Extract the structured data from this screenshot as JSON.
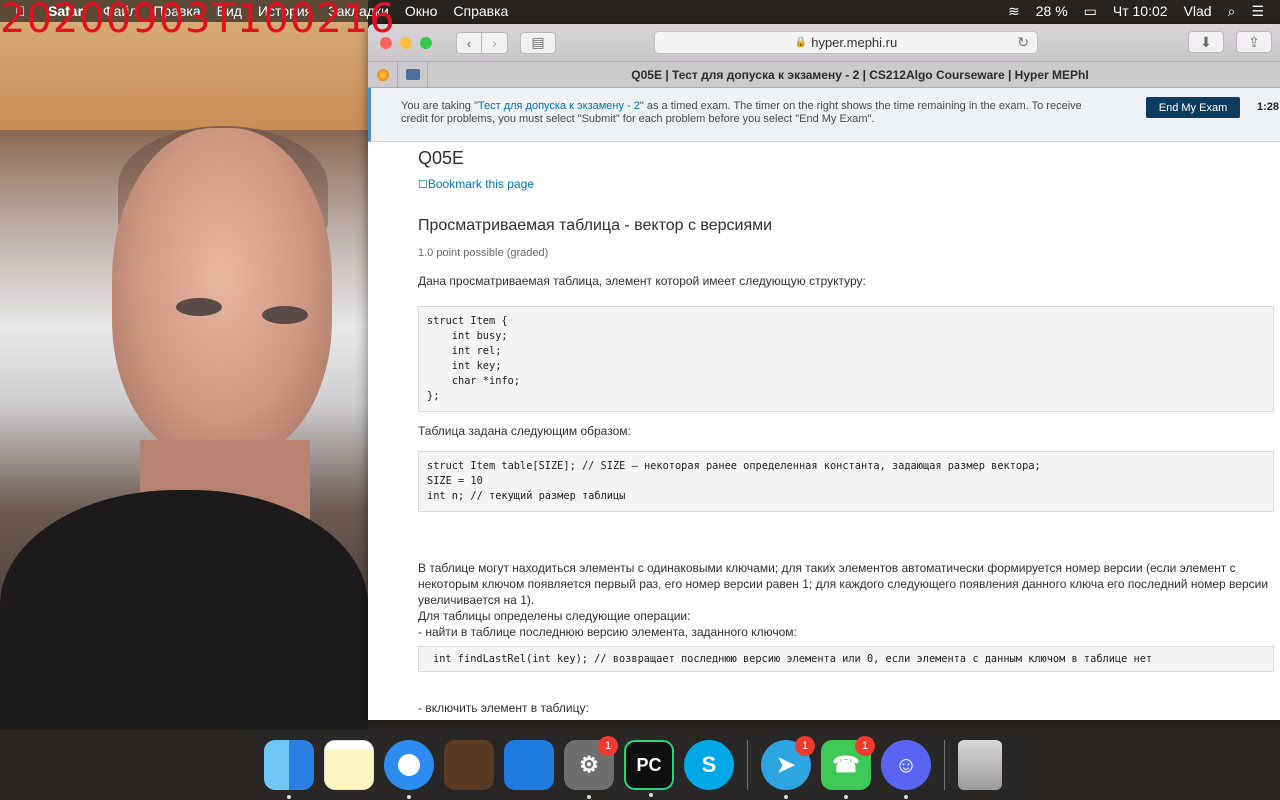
{
  "recording": {
    "stamp": "20200903T100216"
  },
  "menubar": {
    "apple_glyph": "",
    "items": [
      "Safari",
      "Файл",
      "Правка",
      "Вид",
      "История",
      "Закладки",
      "Окно",
      "Справка"
    ],
    "status": {
      "battery": "28 %",
      "clock": "Чт 10:02",
      "user": "Vlad"
    }
  },
  "browser": {
    "url": "hyper.mephi.ru",
    "tab_title": "Q05E | Тест для допуска к экзамену - 2 | CS212Algo Courseware | Hyper MEPhI"
  },
  "exam_banner": {
    "text_before": "You are taking \"",
    "exam_link": "Тест для допуска к экзамену - 2",
    "text_after": "\" as a timed exam. The timer on the right shows the time remaining in the exam. To receive credit for problems, you must select \"Submit\" for each problem before you select \"End My Exam\".",
    "end_button": "End My Exam",
    "timer": "1:28:"
  },
  "content": {
    "unit_title": "Q05E",
    "bookmark_icon": "☐",
    "bookmark": "Bookmark this page",
    "problem_title": "Просматриваемая таблица - вектор с версиями",
    "points": "1.0 point possible (graded)",
    "intro": "Дана просматриваемая таблица, элемент которой имеет следующую структуру:",
    "struct_code": "struct Item {\n    int busy;\n    int rel;\n    int key;\n    char *info;\n};",
    "table_def_text": "Таблица задана следующим образом:",
    "table_code": "struct Item table[SIZE]; // SIZE — некоторая ранее определенная константа, задающая размер вектора;\nSIZE = 10\nint n; // текущий размер таблицы",
    "versions_para": "В таблице могут находиться элементы с одинаковыми ключами; для таких элементов автоматически формируется номер версии (если элемент с некоторым ключом появляется первый раз, его номер версии равен 1; для каждого следующего появления данного ключа его последний номер версии увеличивается на 1).",
    "ops_intro": "Для таблицы определены следующие операции:",
    "op_find": "- найти в таблице последнюю версию элемента, заданного ключом:",
    "find_code": "int findLastRel(int key); // возвращает последнюю версию элемента или 0, если элемента с данным ключом в таблице нет",
    "op_include": "- включить элемент в таблицу:"
  },
  "dock": {
    "apps": [
      {
        "name": "Finder",
        "glyph": ""
      },
      {
        "name": "Notes",
        "glyph": ""
      },
      {
        "name": "Safari",
        "glyph": ""
      },
      {
        "name": "GarageBand",
        "glyph": ""
      },
      {
        "name": "Xcode",
        "glyph": ""
      },
      {
        "name": "System Preferences",
        "glyph": "⚙",
        "badge": "1"
      },
      {
        "name": "PyCharm",
        "glyph": "PC"
      },
      {
        "name": "Skype",
        "glyph": "S"
      },
      {
        "name": "Telegram",
        "glyph": "➤",
        "badge": "1"
      },
      {
        "name": "FaceTime",
        "glyph": "☎",
        "badge": "1"
      },
      {
        "name": "Discord",
        "glyph": "☺"
      },
      {
        "name": "Trash",
        "glyph": ""
      }
    ]
  }
}
